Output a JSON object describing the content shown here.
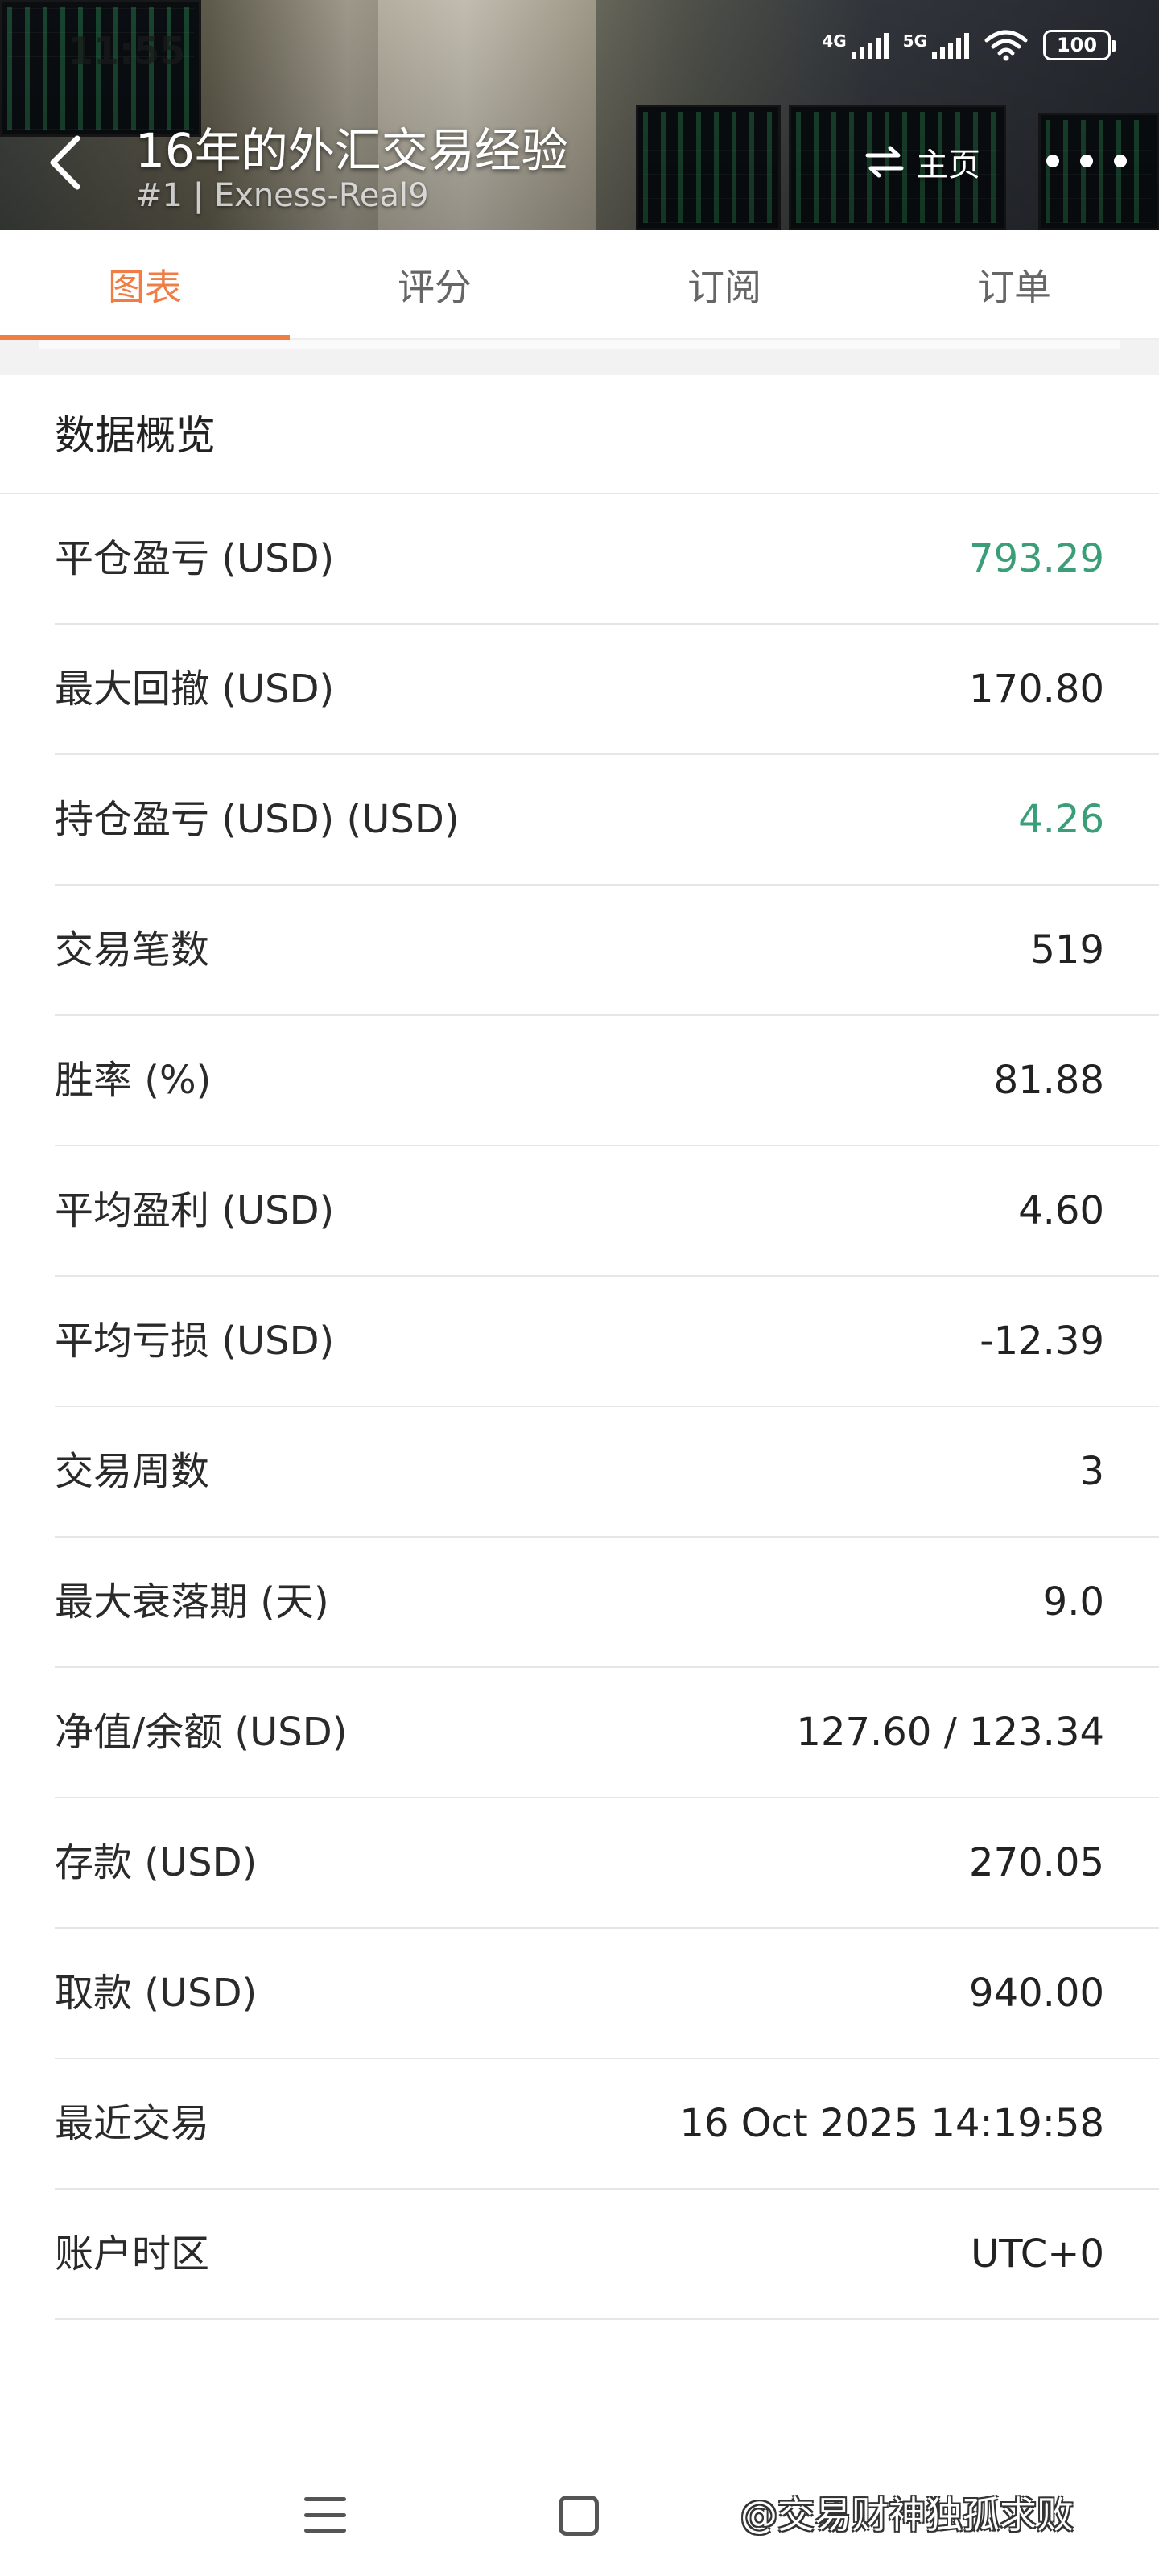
{
  "status_bar": {
    "time": "11:55",
    "network_1": "4G",
    "network_2": "5G",
    "battery": "100"
  },
  "header": {
    "title": "16年的外汇交易经验",
    "subtitle": "#1 | Exness-Real9",
    "home_label": "主页"
  },
  "tabs": [
    {
      "label": "图表",
      "active": true
    },
    {
      "label": "评分",
      "active": false
    },
    {
      "label": "订阅",
      "active": false
    },
    {
      "label": "订单",
      "active": false
    }
  ],
  "overview": {
    "title": "数据概览",
    "rows": [
      {
        "label": "平仓盈亏 (USD)",
        "value": "793.29",
        "color": "#3a9e78"
      },
      {
        "label": "最大回撤 (USD)",
        "value": "170.80"
      },
      {
        "label": "持仓盈亏 (USD) (USD)",
        "value": "4.26",
        "color": "#3a9e78"
      },
      {
        "label": "交易笔数",
        "value": "519"
      },
      {
        "label": "胜率 (%)",
        "value": "81.88"
      },
      {
        "label": "平均盈利 (USD)",
        "value": "4.60"
      },
      {
        "label": "平均亏损 (USD)",
        "value": "-12.39"
      },
      {
        "label": "交易周数",
        "value": "3"
      },
      {
        "label": "最大衰落期 (天)",
        "value": "9.0"
      },
      {
        "label": "净值/余额 (USD)",
        "value": "127.60 / 123.34"
      },
      {
        "label": "存款 (USD)",
        "value": "270.05"
      },
      {
        "label": "取款 (USD)",
        "value": "940.00"
      },
      {
        "label": "最近交易",
        "value": "16 Oct 2025 14:19:58"
      },
      {
        "label": "账户时区",
        "value": "UTC+0"
      }
    ]
  },
  "watermark": "@交易财神独孤求败",
  "colors": {
    "accent": "#ef7d44",
    "positive": "#3a9e78"
  }
}
